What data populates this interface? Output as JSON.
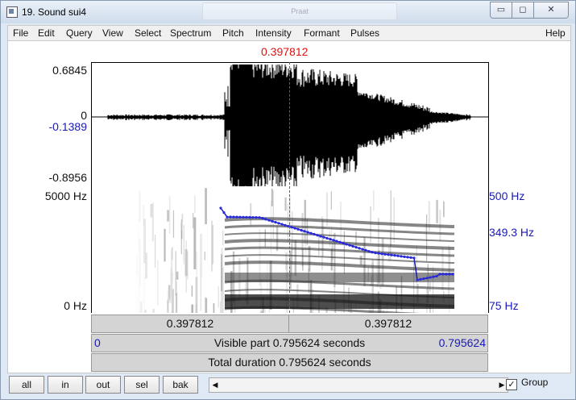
{
  "window": {
    "title": "19. Sound sui4",
    "ghost_title": "Praat"
  },
  "window_buttons": {
    "minimize": "▭",
    "maximize": "◻",
    "close": "✕"
  },
  "menu": [
    "File",
    "Edit",
    "Query",
    "View",
    "Select",
    "Spectrum",
    "Pitch",
    "Intensity",
    "Formant",
    "Pulses"
  ],
  "menu_help": "Help",
  "cursor": {
    "time": "0.397812",
    "color": "#e01010"
  },
  "waveform": {
    "ymax": "0.6845",
    "zero": "0",
    "value_at_cursor": "-0.1389",
    "ymin": "-0.8956"
  },
  "spectrogram": {
    "fmax": "5000 Hz",
    "fmin": "0 Hz"
  },
  "pitch": {
    "top": "500 Hz",
    "value_at_cursor": "349.3 Hz",
    "bottom": "75 Hz",
    "color": "#1a1ab4"
  },
  "time_bars": {
    "left_part": "0.397812",
    "right_part": "0.397812",
    "visible_start": "0",
    "visible_label": "Visible part 0.795624 seconds",
    "visible_end": "0.795624",
    "total_label": "Total duration 0.795624 seconds"
  },
  "buttons": {
    "all": "all",
    "in": "in",
    "out": "out",
    "sel": "sel",
    "bak": "bak"
  },
  "scroll": {
    "left_arrow": "◀",
    "right_arrow": "▶"
  },
  "group": {
    "label": "Group",
    "checked": true,
    "check_glyph": "✓"
  }
}
